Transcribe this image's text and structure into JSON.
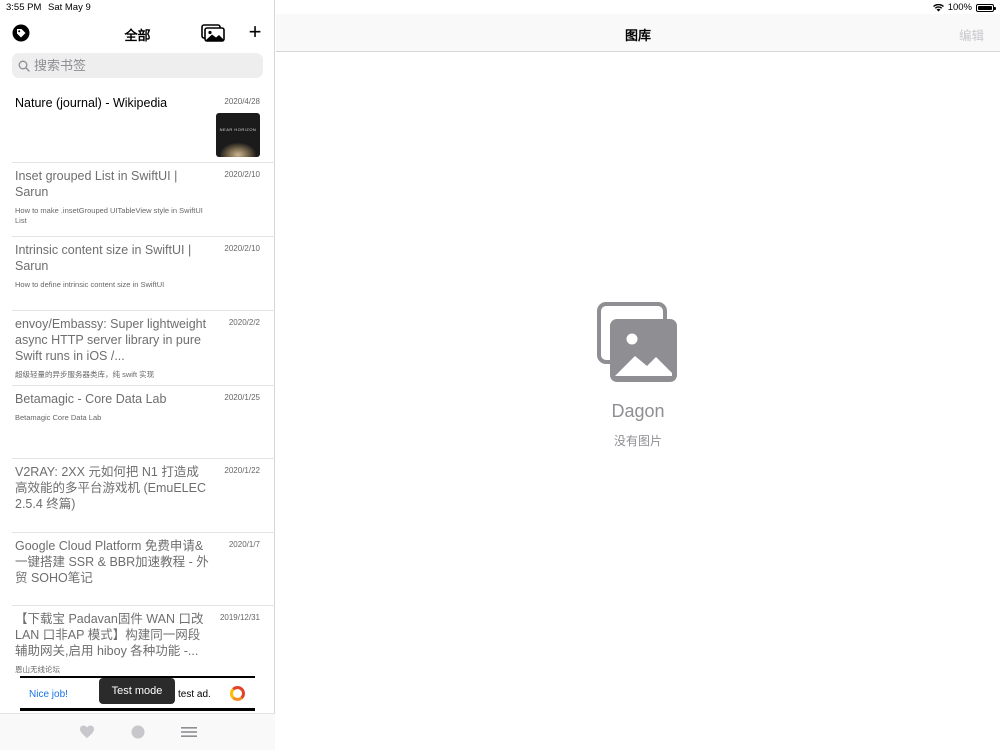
{
  "status_bar": {
    "time": "3:55 PM",
    "date": "Sat May 9",
    "battery": "100%",
    "battery_level": 1.0
  },
  "sidebar": {
    "title": "全部",
    "search": {
      "placeholder": "搜索书签"
    },
    "icons": {
      "tag": "tag-icon",
      "gallery": "photo-gallery-icon",
      "add": "plus-icon"
    },
    "add_glyph": "+",
    "bookmarks": [
      {
        "title": "Nature (journal) - Wikipedia",
        "subtitle": "",
        "date": "2020/4/28",
        "thumbnail_text": "NEAR HORIZON"
      },
      {
        "title": "Inset grouped List in SwiftUI | Sarun",
        "subtitle": "How to make .insetGrouped UITableView style in SwiftUI List",
        "date": "2020/2/10"
      },
      {
        "title": "Intrinsic content size in SwiftUI | Sarun",
        "subtitle": "How to define intrinsic content size in SwiftUI",
        "date": "2020/2/10"
      },
      {
        "title": "envoy/Embassy: Super lightweight async HTTP server library in pure Swift runs in iOS /...",
        "subtitle": "超级轻量的异步服务器类库，纯 swift 实现",
        "date": "2020/2/2"
      },
      {
        "title": "Betamagic - Core Data Lab",
        "subtitle": "Betamagic Core Data Lab",
        "date": "2020/1/25"
      },
      {
        "title": "V2RAY: 2XX 元如何把 N1 打造成高效能的多平台游戏机 (EmuELEC 2.5.4 终篇)",
        "subtitle": "",
        "date": "2020/1/22"
      },
      {
        "title": "Google Cloud Platform 免费申请& 一键搭建 SSR & BBR加速教程 - 外贸 SOHO笔记",
        "subtitle": "",
        "date": "2020/1/7"
      },
      {
        "title": "【下载宝 Padavan固件 WAN 口改 LAN 口非AP 模式】构建同一网段辅助网关,启用 hiboy 各种功能 -...",
        "subtitle": "恩山无线论坛",
        "date": "2019/12/31"
      }
    ],
    "ad": {
      "left_text": "Nice job!",
      "right_text": "test ad.",
      "toast": "Test mode"
    },
    "tabs": [
      {
        "icon": "heart-icon"
      },
      {
        "icon": "circle-icon"
      },
      {
        "icon": "menu-icon"
      }
    ]
  },
  "detail": {
    "title": "图库",
    "edit_label": "编辑",
    "empty_state": {
      "icon": "photo-gallery-icon",
      "name": "Dagon",
      "message": "没有图片"
    }
  },
  "colors": {
    "accent": "#000000",
    "muted": "#8e8e93",
    "disabled": "#c7c7cc",
    "ad_link": "#1a73e8"
  }
}
